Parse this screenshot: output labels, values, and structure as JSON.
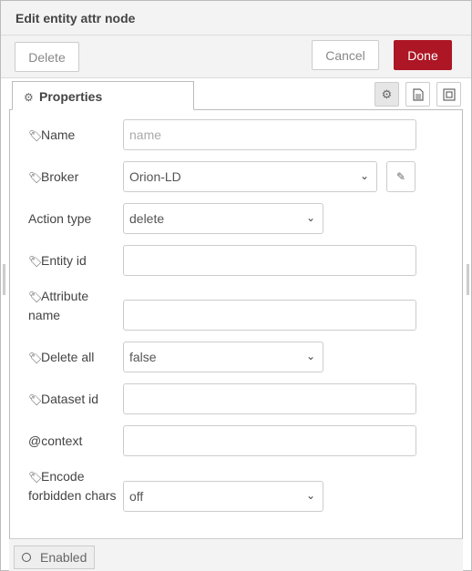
{
  "dialog": {
    "title": "Edit entity attr node",
    "delete_label": "Delete",
    "cancel_label": "Cancel",
    "done_label": "Done",
    "tab_label": "Properties",
    "enabled_label": "Enabled"
  },
  "form": {
    "name": {
      "label": "Name",
      "placeholder": "name",
      "value": ""
    },
    "broker": {
      "label": "Broker",
      "value": "Orion-LD"
    },
    "action_type": {
      "label": "Action type",
      "value": "delete"
    },
    "entity_id": {
      "label": "Entity id",
      "value": ""
    },
    "attribute_name": {
      "label_line1": "Attribute",
      "label_line2": "name",
      "value": ""
    },
    "delete_all": {
      "label": "Delete all",
      "value": "false"
    },
    "dataset_id": {
      "label": "Dataset id",
      "value": ""
    },
    "context": {
      "label": "@context",
      "value": ""
    },
    "encode": {
      "label_line1": "Encode",
      "label_line2": "forbidden chars",
      "value": "off"
    }
  },
  "colors": {
    "done_button": "#ad1625",
    "header_bg": "#f3f3f3"
  },
  "icons": {
    "tab": "gear-icon",
    "tab_tools": [
      "gear-icon",
      "document-icon",
      "frame-icon"
    ],
    "edit": "pencil-icon",
    "label": "tag-icon"
  }
}
